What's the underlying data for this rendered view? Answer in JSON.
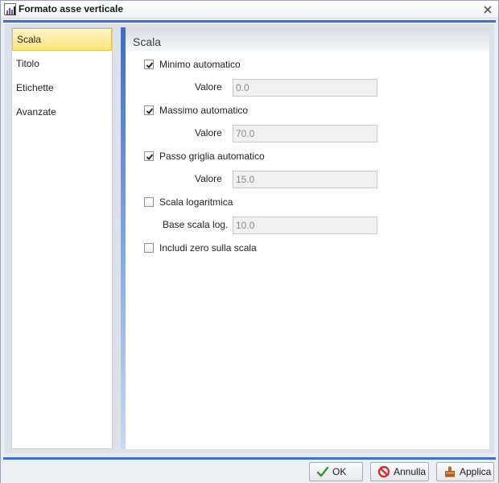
{
  "window": {
    "title": "Formato asse verticale",
    "close_glyph": "×",
    "app_icon": "chart-app-icon"
  },
  "sidebar": {
    "items": [
      {
        "label": "Scala",
        "selected": true
      },
      {
        "label": "Titolo",
        "selected": false
      },
      {
        "label": "Etichette",
        "selected": false
      },
      {
        "label": "Avanzate",
        "selected": false
      }
    ]
  },
  "panel": {
    "title": "Scala",
    "options": {
      "min_auto": {
        "label": "Minimo automatico",
        "checked": true
      },
      "min_value": {
        "label": "Valore",
        "value": "0.0"
      },
      "max_auto": {
        "label": "Massimo automatico",
        "checked": true
      },
      "max_value": {
        "label": "Valore",
        "value": "70.0"
      },
      "step_auto": {
        "label": "Passo griglia automatico",
        "checked": true
      },
      "step_value": {
        "label": "Valore",
        "value": "15.0"
      },
      "log_scale": {
        "label": "Scala logaritmica",
        "checked": false
      },
      "log_base": {
        "label": "Base scala log.",
        "value": "10.0"
      },
      "include_zero": {
        "label": "Includi zero sulla scala",
        "checked": false
      }
    }
  },
  "footer": {
    "ok_label": "OK",
    "cancel_label": "Annulla",
    "apply_label": "Applica"
  },
  "colors": {
    "accent_blue": "#3f6fc8",
    "selected_item": "#ffe47a",
    "ok_check": "#2e9a2e",
    "cancel_red": "#d22424"
  }
}
